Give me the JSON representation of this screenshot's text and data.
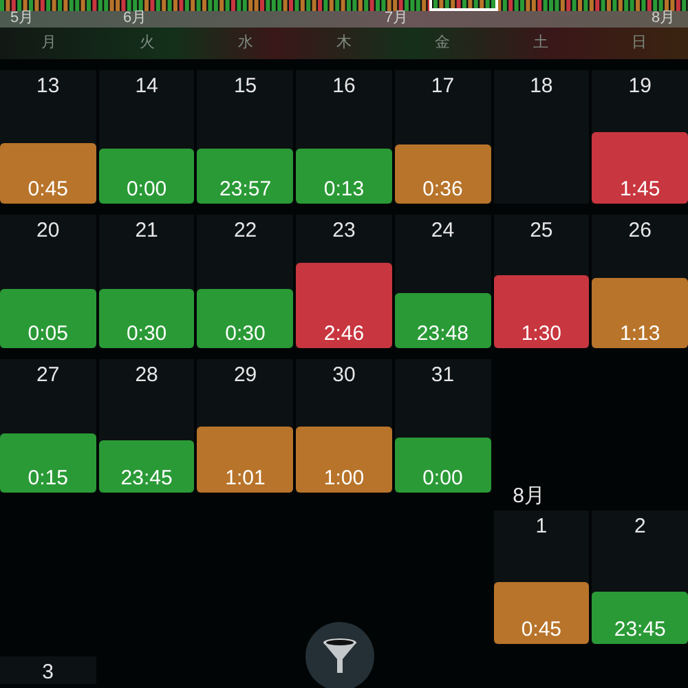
{
  "timeline": {
    "months": [
      {
        "label": "5月"
      },
      {
        "label": "6月"
      },
      {
        "label": "7月"
      },
      {
        "label": "8月"
      }
    ]
  },
  "weekdays": [
    "月",
    "火",
    "水",
    "木",
    "金",
    "土",
    "日"
  ],
  "weeks": [
    {
      "days": [
        {
          "kind": "day",
          "day": "13",
          "time": "0:45",
          "color": "#b8742a"
        },
        {
          "kind": "day",
          "day": "14",
          "time": "0:00",
          "color": "#2a9a36"
        },
        {
          "kind": "day",
          "day": "15",
          "time": "23:57",
          "color": "#2a9a36"
        },
        {
          "kind": "day",
          "day": "16",
          "time": "0:13",
          "color": "#2a9a36"
        },
        {
          "kind": "day",
          "day": "17",
          "time": "0:36",
          "color": "#b8742a"
        },
        {
          "kind": "day",
          "day": "18"
        },
        {
          "kind": "day",
          "day": "19",
          "time": "1:45",
          "color": "#c8363f"
        }
      ]
    },
    {
      "days": [
        {
          "kind": "day",
          "day": "20",
          "time": "0:05",
          "color": "#2a9a36"
        },
        {
          "kind": "day",
          "day": "21",
          "time": "0:30",
          "color": "#2a9a36"
        },
        {
          "kind": "day",
          "day": "22",
          "time": "0:30",
          "color": "#2a9a36"
        },
        {
          "kind": "day",
          "day": "23",
          "time": "2:46",
          "color": "#c8363f"
        },
        {
          "kind": "day",
          "day": "24",
          "time": "23:48",
          "color": "#2a9a36"
        },
        {
          "kind": "day",
          "day": "25",
          "time": "1:30",
          "color": "#c8363f"
        },
        {
          "kind": "day",
          "day": "26",
          "time": "1:13",
          "color": "#b8742a"
        }
      ]
    },
    {
      "days": [
        {
          "kind": "day",
          "day": "27",
          "time": "0:15",
          "color": "#2a9a36"
        },
        {
          "kind": "day",
          "day": "28",
          "time": "23:45",
          "color": "#2a9a36"
        },
        {
          "kind": "day",
          "day": "29",
          "time": "1:01",
          "color": "#b8742a"
        },
        {
          "kind": "day",
          "day": "30",
          "time": "1:00",
          "color": "#b8742a"
        },
        {
          "kind": "day",
          "day": "31",
          "time": "0:00",
          "color": "#2a9a36"
        },
        {
          "kind": "empty"
        },
        {
          "kind": "empty"
        }
      ]
    },
    {
      "month_label": "8月",
      "days": [
        {
          "kind": "empty"
        },
        {
          "kind": "empty"
        },
        {
          "kind": "empty"
        },
        {
          "kind": "empty"
        },
        {
          "kind": "empty"
        },
        {
          "kind": "day",
          "day": "1",
          "time": "0:45",
          "color": "#b8742a"
        },
        {
          "kind": "day",
          "day": "2",
          "time": "23:45",
          "color": "#2a9a36"
        }
      ]
    },
    {
      "days": [
        {
          "kind": "day",
          "day": "3"
        }
      ]
    }
  ]
}
